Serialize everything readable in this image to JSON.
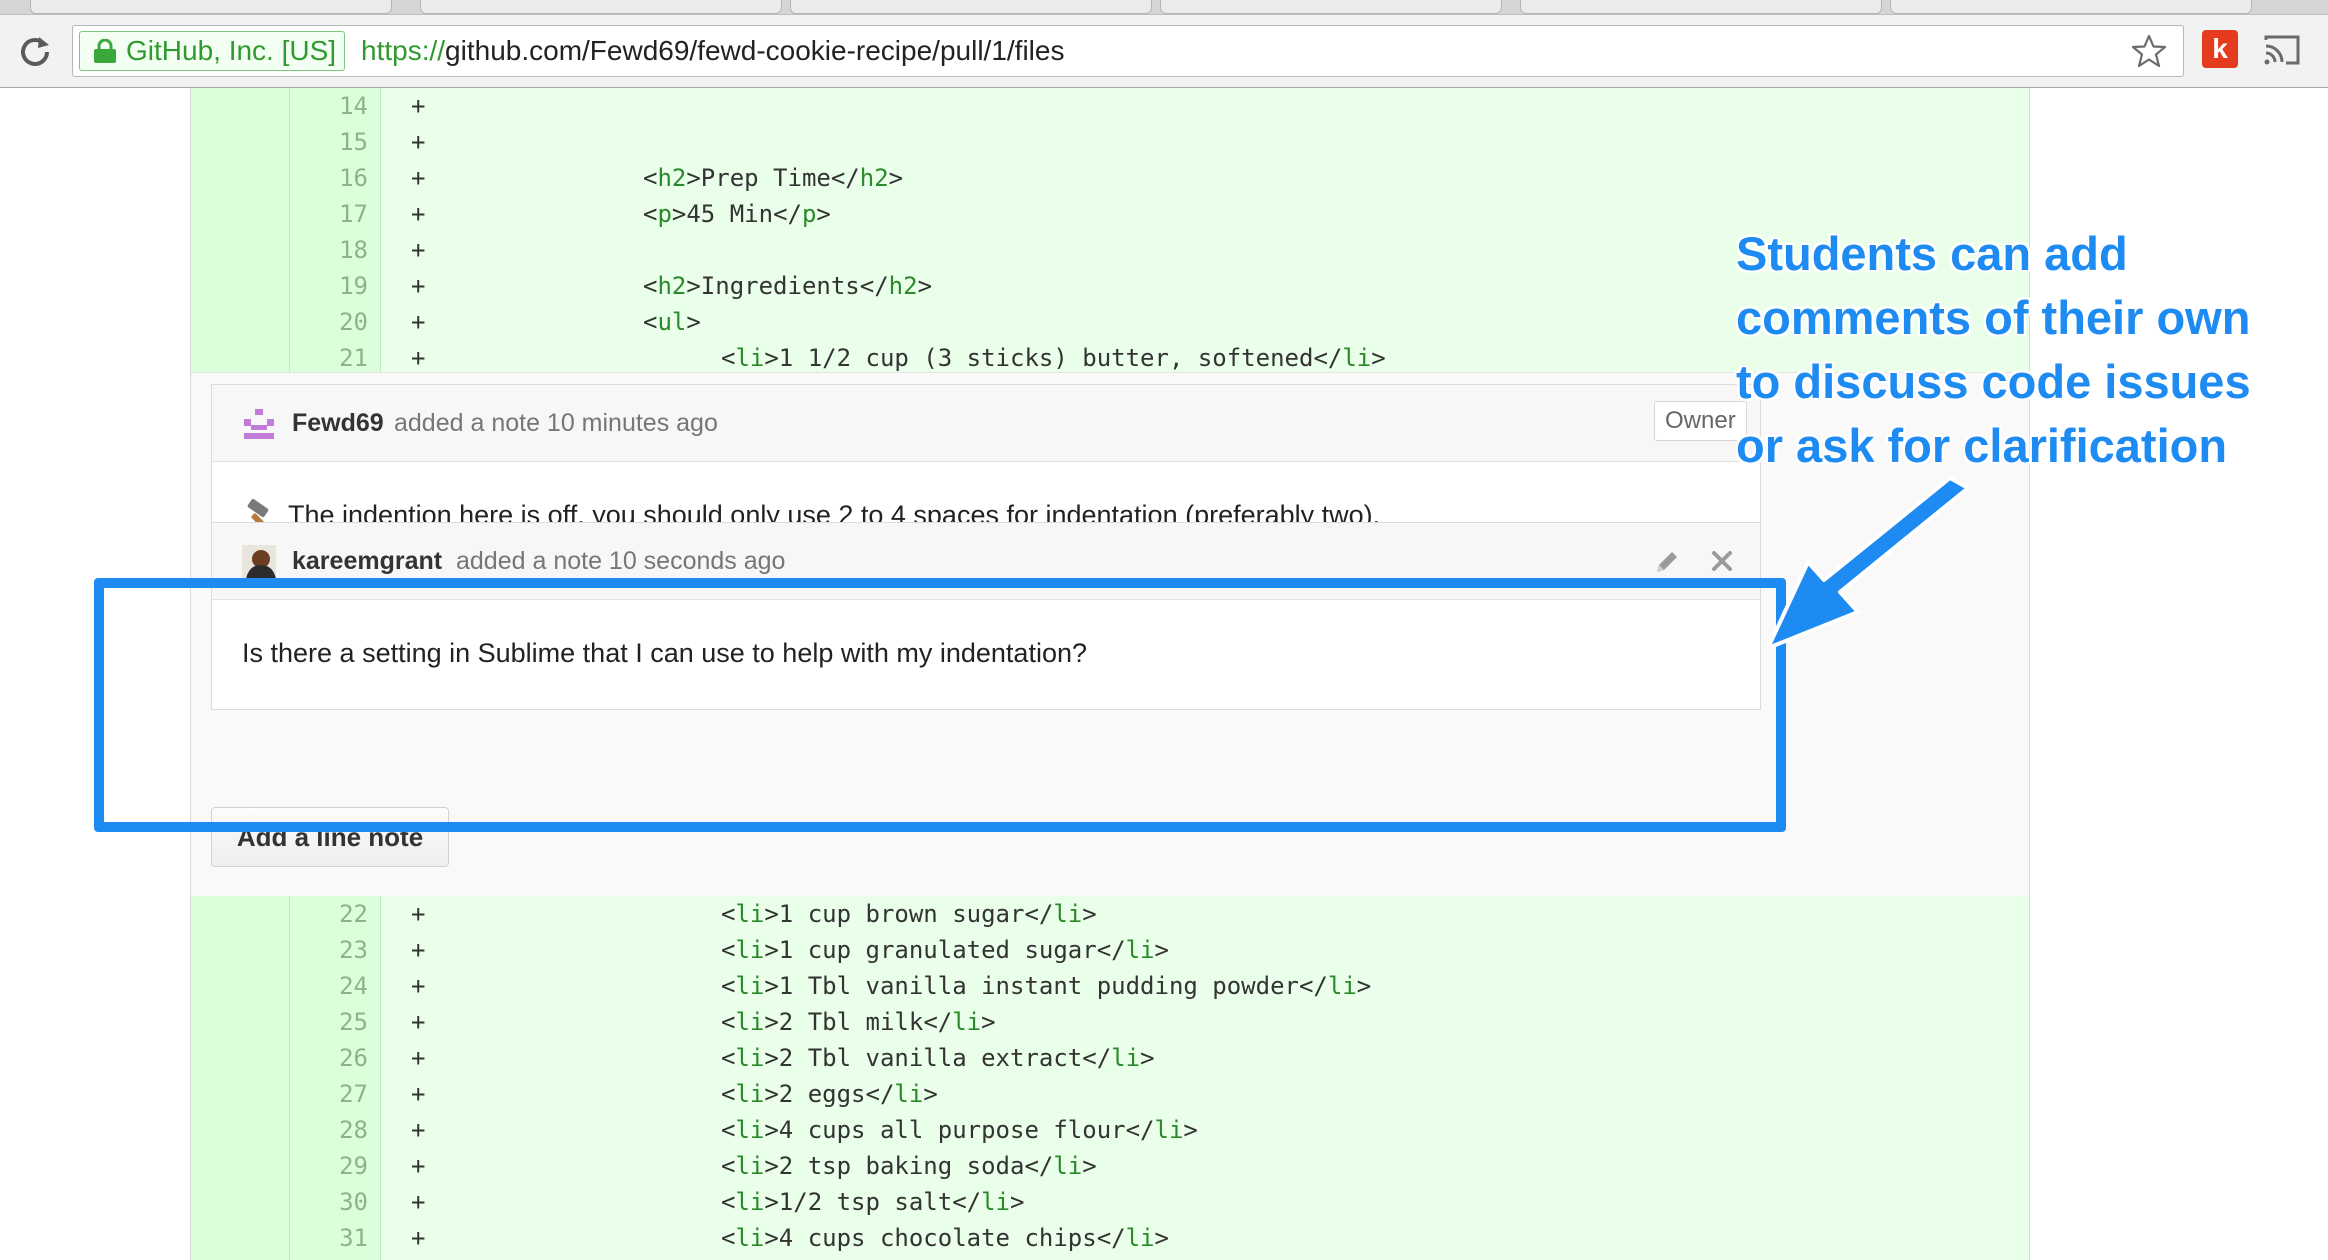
{
  "browser": {
    "ev_cert": "GitHub, Inc. [US]",
    "url_scheme": "https://",
    "url_rest": "github.com/Fewd69/fewd-cookie-recipe/pull/1/files",
    "extension_label": "k"
  },
  "diff_top": [
    {
      "num": "14",
      "sign": "+",
      "indent": 0,
      "open": "",
      "text": "",
      "close": ""
    },
    {
      "num": "15",
      "sign": "+",
      "indent": 0,
      "open": "",
      "text": "",
      "close": ""
    },
    {
      "num": "16",
      "sign": "+",
      "indent": 1,
      "open": "h2",
      "text": "Prep Time",
      "close": "h2"
    },
    {
      "num": "17",
      "sign": "+",
      "indent": 1,
      "open": "p",
      "text": "45 Min",
      "close": "p"
    },
    {
      "num": "18",
      "sign": "+",
      "indent": 0,
      "open": "",
      "text": "",
      "close": ""
    },
    {
      "num": "19",
      "sign": "+",
      "indent": 1,
      "open": "h2",
      "text": "Ingredients",
      "close": "h2"
    },
    {
      "num": "20",
      "sign": "+",
      "indent": 1,
      "open": "ul",
      "text": "",
      "close": ""
    },
    {
      "num": "21",
      "sign": "+",
      "indent": 2,
      "open": "li",
      "text": "1 1/2 cup (3 sticks) butter, softened",
      "close": "li"
    }
  ],
  "diff_bottom": [
    {
      "num": "22",
      "sign": "+",
      "indent": 2,
      "open": "li",
      "text": "1 cup brown sugar",
      "close": "li"
    },
    {
      "num": "23",
      "sign": "+",
      "indent": 2,
      "open": "li",
      "text": "1 cup granulated sugar",
      "close": "li"
    },
    {
      "num": "24",
      "sign": "+",
      "indent": 2,
      "open": "li",
      "text": "1 Tbl vanilla instant pudding powder",
      "close": "li"
    },
    {
      "num": "25",
      "sign": "+",
      "indent": 2,
      "open": "li",
      "text": "2 Tbl milk",
      "close": "li"
    },
    {
      "num": "26",
      "sign": "+",
      "indent": 2,
      "open": "li",
      "text": "2 Tbl vanilla extract",
      "close": "li"
    },
    {
      "num": "27",
      "sign": "+",
      "indent": 2,
      "open": "li",
      "text": "2 eggs",
      "close": "li"
    },
    {
      "num": "28",
      "sign": "+",
      "indent": 2,
      "open": "li",
      "text": "4 cups all purpose flour",
      "close": "li"
    },
    {
      "num": "29",
      "sign": "+",
      "indent": 2,
      "open": "li",
      "text": "2 tsp baking soda",
      "close": "li"
    },
    {
      "num": "30",
      "sign": "+",
      "indent": 2,
      "open": "li",
      "text": "1/2 tsp salt",
      "close": "li"
    },
    {
      "num": "31",
      "sign": "+",
      "indent": 2,
      "open": "li",
      "text": "4 cups chocolate chips",
      "close": "li"
    }
  ],
  "comment1": {
    "author": "Fewd69",
    "meta": "added a note 10 minutes ago",
    "badge": "Owner",
    "body": "The indention here is off, you should only use 2 to 4 spaces for indentation (preferably two)."
  },
  "comment2": {
    "author": "kareemgrant",
    "meta": "added a note 10 seconds ago",
    "body": "Is there a setting in Sublime that I can use to help with my indentation?"
  },
  "add_note_label": "Add a line note",
  "annotation": {
    "lines": [
      "Students can add",
      "comments of their own",
      "to discuss code issues",
      "or ask for clarification"
    ],
    "color": "#1e8bf2"
  }
}
